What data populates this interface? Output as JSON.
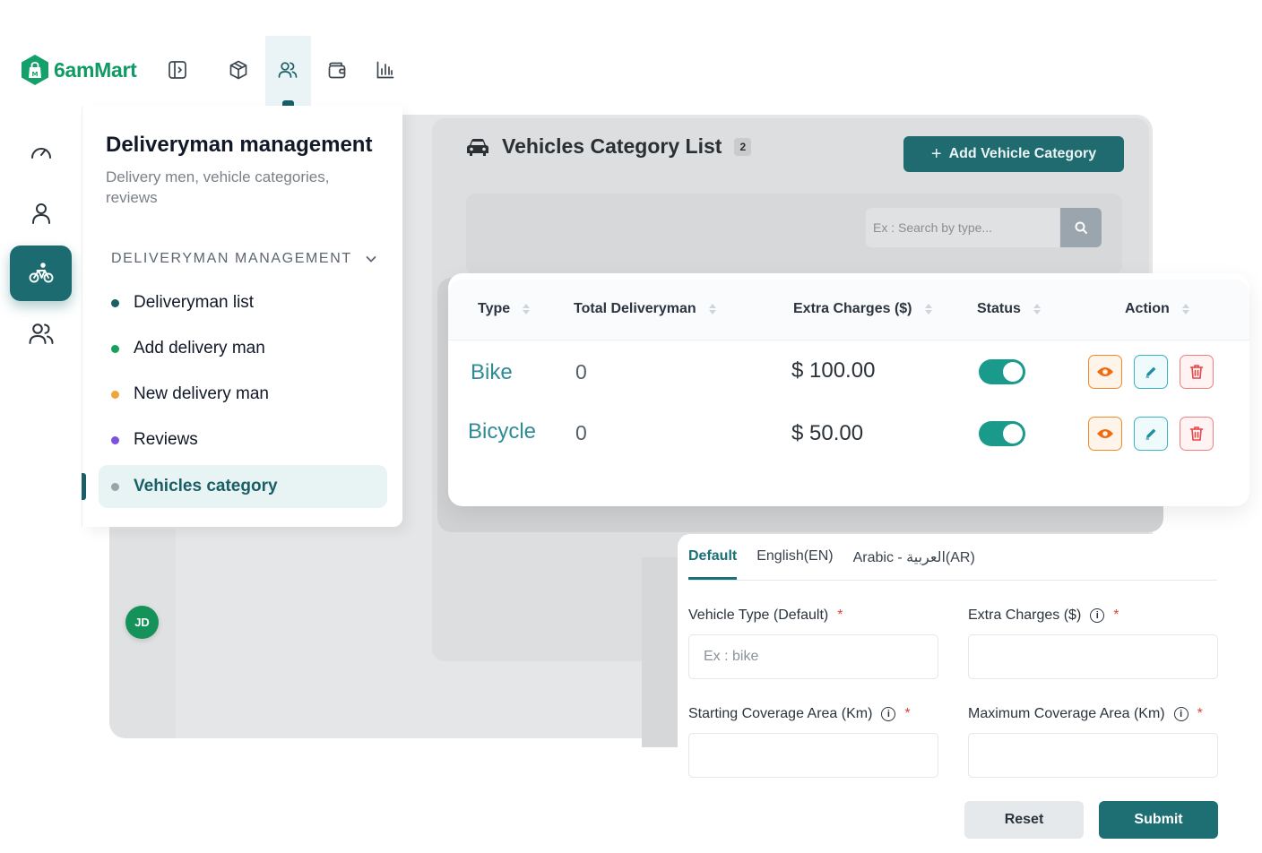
{
  "app": {
    "name": "6amMart"
  },
  "topbar": {
    "icons": [
      "sidebar-toggle-icon",
      "package-icon",
      "users-icon",
      "wallet-icon",
      "bar-chart-icon"
    ],
    "active": "users-icon"
  },
  "rail": {
    "icons": [
      "dashboard-icon",
      "user-icon",
      "bicycle-icon",
      "users-icon"
    ],
    "active": "bicycle-icon"
  },
  "submenu": {
    "title": "Deliveryman management",
    "subtitle": "Delivery men, vehicle categories, reviews",
    "section": "DELIVERYMAN MANAGEMENT",
    "items": [
      {
        "label": "Deliveryman list",
        "dot_color": "#1a5f66"
      },
      {
        "label": "Add delivery man",
        "dot_color": "#17a05d"
      },
      {
        "label": "New delivery man",
        "dot_color": "#f0a53a"
      },
      {
        "label": "Reviews",
        "dot_color": "#7b52e0"
      },
      {
        "label": "Vehicles category",
        "dot_color": "#9aa3ab",
        "active": true
      }
    ]
  },
  "background_page": {
    "title": "Vehicles Category List",
    "count": "2",
    "add_button": "Add Vehicle Category",
    "search_placeholder": "Ex : Search by type..."
  },
  "table": {
    "headers": [
      "Type",
      "Total Deliveryman",
      "Extra Charges ($)",
      "Status",
      "Action"
    ],
    "rows": [
      {
        "type": "Bike",
        "total": "0",
        "charges": "$ 100.00",
        "status": true
      },
      {
        "type": "Bicycle",
        "total": "0",
        "charges": "$ 50.00",
        "status": true
      }
    ]
  },
  "user": {
    "initials": "JD"
  },
  "form": {
    "tabs": [
      "Default",
      "English(EN)",
      "Arabic - العربية(AR)"
    ],
    "active_tab": "Default",
    "fields": {
      "vehicle_type": {
        "label": "Vehicle Type (Default)",
        "placeholder": "Ex : bike"
      },
      "extra_charges": {
        "label": "Extra Charges ($)"
      },
      "starting_coverage": {
        "label": "Starting Coverage Area (Km)"
      },
      "maximum_coverage": {
        "label": "Maximum Coverage Area (Km)"
      }
    },
    "required_mark": "*",
    "reset_label": "Reset",
    "submit_label": "Submit"
  },
  "colors": {
    "primary": "#1d6f74",
    "accent_green": "#0f9a66",
    "view_orange": "#f08a2a",
    "edit_teal": "#3bb4c4",
    "delete_red": "#f07f7f"
  }
}
